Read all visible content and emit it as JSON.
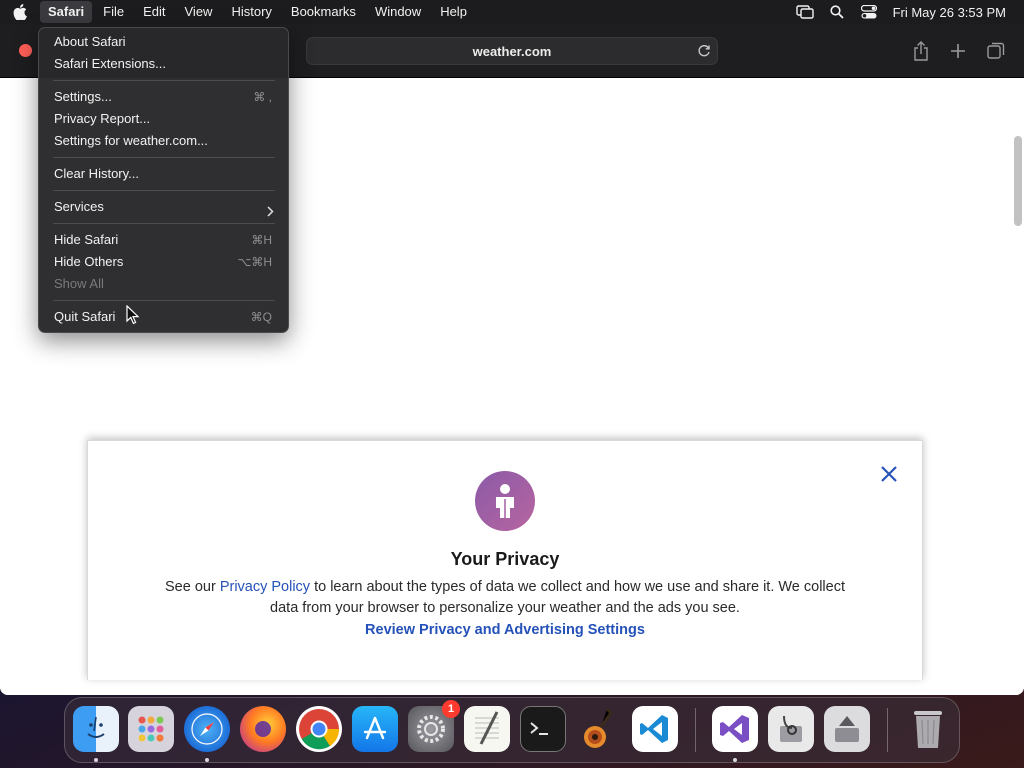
{
  "menubar": {
    "app_menu": "Safari",
    "items": [
      "File",
      "Edit",
      "View",
      "History",
      "Bookmarks",
      "Window",
      "Help"
    ],
    "clock": "Fri May 26  3:53 PM"
  },
  "browser": {
    "url": "weather.com"
  },
  "safari_menu": {
    "about": "About Safari",
    "extensions": "Safari Extensions...",
    "settings": "Settings...",
    "settings_shortcut": "⌘ ,",
    "privacy_report": "Privacy Report...",
    "site_settings": "Settings for weather.com...",
    "clear_history": "Clear History...",
    "services": "Services",
    "hide_safari": "Hide Safari",
    "hide_safari_shortcut": "⌘H",
    "hide_others": "Hide Others",
    "hide_others_shortcut": "⌥⌘H",
    "show_all": "Show All",
    "quit": "Quit Safari",
    "quit_shortcut": "⌘Q"
  },
  "privacy_modal": {
    "title": "Your Privacy",
    "body_before": "See our ",
    "body_link": "Privacy Policy",
    "body_after": " to learn about the types of data we collect and how we use and share it. We collect data from your browser to personalize your weather and the ads you see.",
    "review_link": "Review Privacy and Advertising Settings"
  },
  "dock": {
    "settings_badge": "1"
  },
  "colors": {
    "link": "#2552b8",
    "privacy_icon": "#9a5fa5"
  }
}
